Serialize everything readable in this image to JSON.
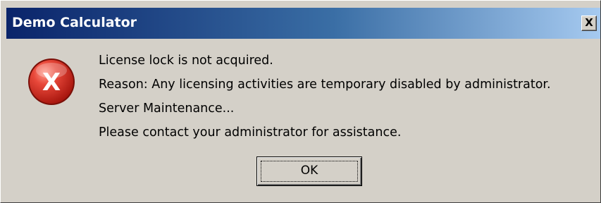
{
  "window": {
    "title": "Demo Calculator",
    "close_glyph": "X"
  },
  "icon": {
    "name": "error-icon",
    "glyph": "X",
    "color": "#d42a1c"
  },
  "message": {
    "lines": [
      "License lock is not acquired.",
      "Reason: Any licensing activities are temporary disabled by administrator.",
      "Server Maintenance...",
      "Please contact your administrator for assistance."
    ]
  },
  "buttons": {
    "ok_label": "OK"
  },
  "colors": {
    "titlebar_start": "#0a246a",
    "titlebar_end": "#a6caf0",
    "dialog_background": "#d4d0c8"
  }
}
